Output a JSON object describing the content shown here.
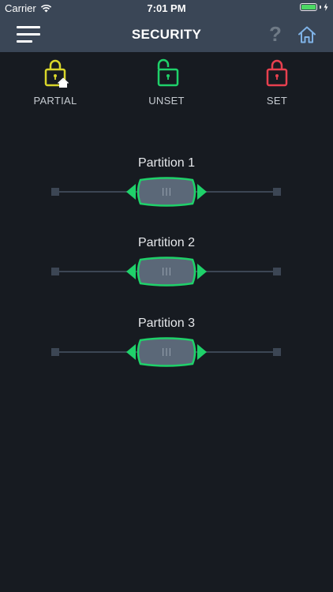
{
  "status": {
    "carrier": "Carrier",
    "time": "7:01 PM"
  },
  "header": {
    "title": "SECURITY",
    "help_label": "?"
  },
  "modes": [
    {
      "label": "PARTIAL",
      "color": "#d9d62a"
    },
    {
      "label": "UNSET",
      "color": "#1fd16a"
    },
    {
      "label": "SET",
      "color": "#e8404f"
    }
  ],
  "partitions": [
    {
      "title": "Partition 1",
      "level": 0.5
    },
    {
      "title": "Partition 2",
      "level": 0.5
    },
    {
      "title": "Partition 3",
      "level": 0.5
    }
  ],
  "colors": {
    "accent": "#1fd16a",
    "knob_fill": "#5b6878",
    "nav": "#3a4656",
    "background": "#171b21"
  },
  "icons": {
    "menu": "hamburger-icon",
    "help": "question-icon",
    "home": "home-icon"
  }
}
